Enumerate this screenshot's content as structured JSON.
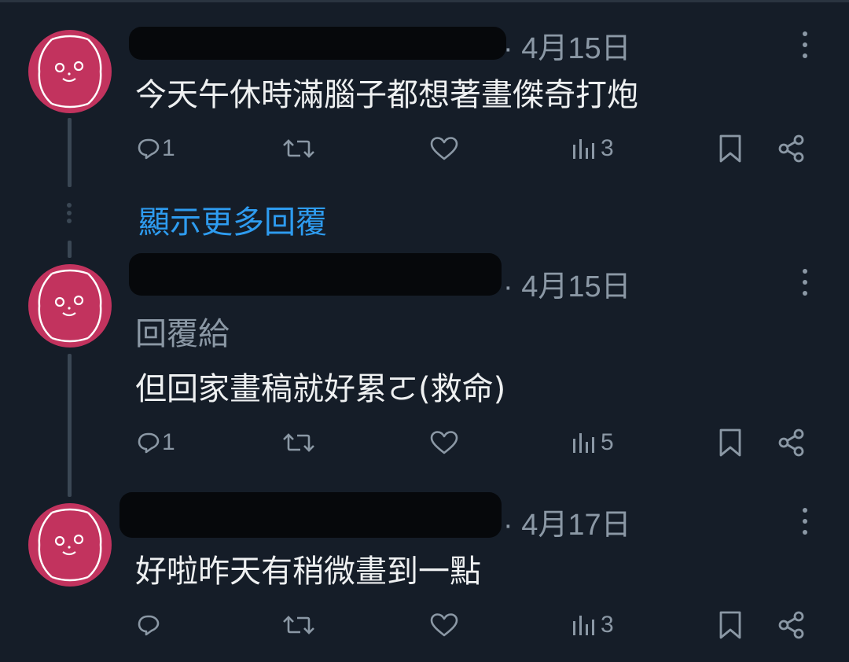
{
  "posts": [
    {
      "date": "· 4月15日",
      "text": "今天午休時滿腦子都想著畫傑奇打炮",
      "reply_to": "",
      "replies": "1",
      "retweets": "",
      "likes": "",
      "views": "3"
    },
    {
      "date": "· 4月15日",
      "text": "但回家畫稿就好累ㄛ(救命)",
      "reply_to": "回覆給",
      "replies": "1",
      "retweets": "",
      "likes": "",
      "views": "5"
    },
    {
      "date": "· 4月17日",
      "text": "好啦昨天有稍微畫到一點",
      "reply_to": "",
      "replies": "",
      "retweets": "",
      "likes": "",
      "views": "3"
    }
  ],
  "show_more_label": "顯示更多回覆",
  "colors": {
    "background": "#151d28",
    "accent": "#2e9cf0",
    "avatar": "#c2335e",
    "muted": "#8b98a5"
  },
  "icons": [
    "reply-icon",
    "retweet-icon",
    "like-icon",
    "views-icon",
    "bookmark-icon",
    "share-icon",
    "more-icon"
  ]
}
